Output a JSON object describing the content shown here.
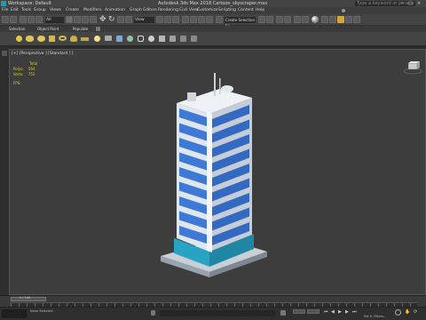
{
  "titlebar": {
    "workspace": "Workspace: Default",
    "title": "Autodesk 3ds Max 2018   Cartoon_skyscraper.max",
    "search_placeholder": "Type a keyword or phrase"
  },
  "menu": [
    "File",
    "Edit",
    "Tools",
    "Group",
    "Views",
    "Create",
    "Modifiers",
    "Animation",
    "Graph Editors",
    "Rendering",
    "Civil View",
    "Customize",
    "Scripting",
    "Content",
    "Help"
  ],
  "toolbar": {
    "selection_filter": "All",
    "view_label": "View",
    "named_selection": "Create Selection Se"
  },
  "ribbon_tabs": [
    "Selection",
    "Object Paint",
    "Populate"
  ],
  "viewport": {
    "label": "[+] [Perspective ] [Standard ] [",
    "stats": {
      "title": "Total",
      "polys_label": "Polys:",
      "polys_value": "564",
      "verts_label": "Verts:",
      "verts_value": "752",
      "fps_label": "FPS:"
    }
  },
  "timeline": {
    "frame": "0 / 100"
  },
  "status": {
    "left": "None Selected",
    "keys": "Set K. Filters..."
  },
  "colors": {
    "glass": "#3f79d6",
    "frame": "#dfe6ee",
    "teal": "#29a3c4",
    "viewport_bg": "#3d3d3d"
  }
}
